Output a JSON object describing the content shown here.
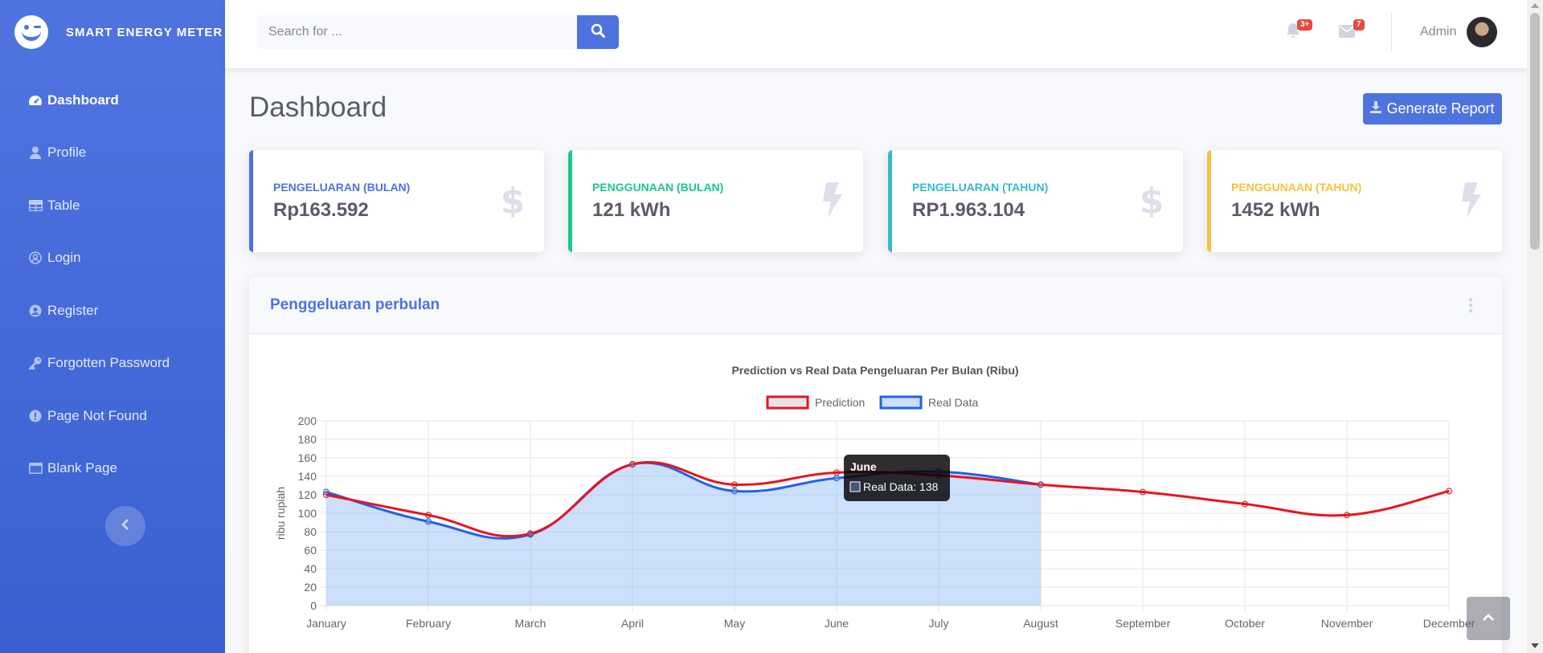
{
  "sidebar": {
    "brand": "SMART ENERGY METER",
    "items": [
      {
        "label": "Dashboard",
        "icon": "tachometer-icon",
        "active": true
      },
      {
        "label": "Profile",
        "icon": "user-icon"
      },
      {
        "label": "Table",
        "icon": "table-icon"
      },
      {
        "label": "Login",
        "icon": "user-circle-icon"
      },
      {
        "label": "Register",
        "icon": "user-circle-solid-icon"
      },
      {
        "label": "Forgotten Password",
        "icon": "key-icon"
      },
      {
        "label": "Page Not Found",
        "icon": "exclamation-circle-icon"
      },
      {
        "label": "Blank Page",
        "icon": "window-icon"
      }
    ]
  },
  "topbar": {
    "search_placeholder": "Search for ...",
    "alerts_badge": "3+",
    "messages_badge": "7",
    "username": "Admin"
  },
  "page": {
    "title": "Dashboard",
    "report_button": "Generate Report"
  },
  "cards": [
    {
      "label": "PENGELUARAN (BULAN)",
      "value": "Rp163.592",
      "color": "#4e73df",
      "icon": "dollar-icon"
    },
    {
      "label": "PENGGUNAAN (BULAN)",
      "value": "121 kWh",
      "color": "#1cc88a",
      "icon": "bolt-icon"
    },
    {
      "label": "PENGELUARAN (TAHUN)",
      "value": "RP1.963.104",
      "color": "#36b9cc",
      "icon": "dollar-icon"
    },
    {
      "label": "PENGGUNAAN (TAHUN)",
      "value": "1452 kWh",
      "color": "#f6c23e",
      "icon": "bolt-icon"
    }
  ],
  "panel": {
    "title": "Penggeluaran perbulan"
  },
  "colors": {
    "primary": "#4e73df",
    "prediction": "#e8141f",
    "real": "#1f63e8",
    "real_fill": "rgba(120,170,245,0.38)"
  },
  "chart_data": {
    "type": "line",
    "title": "Prediction vs Real Data Pengeluaran Per Bulan (Ribu)",
    "xlabel": "",
    "ylabel": "ribu rupiah",
    "categories": [
      "January",
      "February",
      "March",
      "April",
      "May",
      "June",
      "July",
      "August",
      "September",
      "October",
      "November",
      "December"
    ],
    "ylim": [
      0,
      200
    ],
    "yticks": [
      0,
      20,
      40,
      60,
      80,
      100,
      120,
      140,
      160,
      180,
      200
    ],
    "grid": true,
    "legend": "top-center",
    "series": [
      {
        "name": "Prediction",
        "values": [
          120,
          98,
          78,
          153,
          131,
          144,
          141,
          131,
          123,
          110,
          98,
          124
        ]
      },
      {
        "name": "Real Data",
        "values": [
          123,
          91,
          77,
          153,
          124,
          138,
          145,
          131,
          null,
          null,
          null,
          null
        ],
        "filled": true
      }
    ],
    "tooltip": {
      "title": "June",
      "label": "Real Data: 138"
    }
  }
}
